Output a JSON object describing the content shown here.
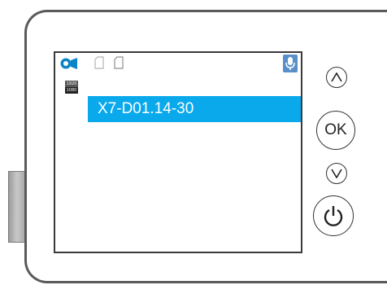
{
  "camera": {
    "status_icons": [
      "video-camera-icon",
      "sd-card-icon",
      "sd-card-icon",
      "microphone-icon"
    ],
    "resolution_icon": {
      "line1": "1920",
      "line2": "1080"
    },
    "selected_item": "X7-D01.14-30",
    "highlight_color": "#0aa9ec",
    "buttons": {
      "up": "up-arrow-icon",
      "ok": "OK",
      "down": "down-arrow-icon",
      "power": "power-icon"
    }
  }
}
